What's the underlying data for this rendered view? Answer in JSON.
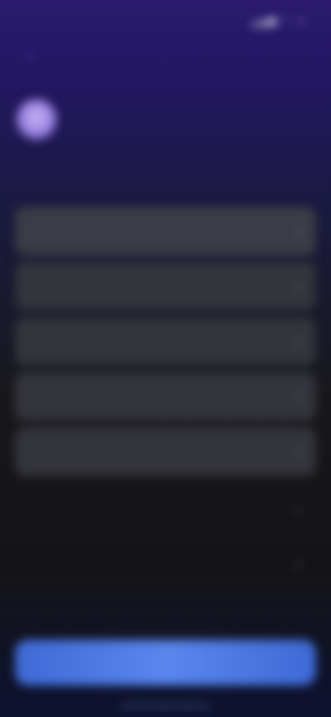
{
  "status_bar": {
    "time": "",
    "icons": [
      "signal-icon",
      "wifi-icon",
      "battery-icon"
    ],
    "icons_text": ""
  },
  "nav": {
    "back_label": ""
  },
  "profile": {
    "initial": "",
    "name": "",
    "subtitle": "",
    "description": ""
  },
  "menu": {
    "items": [
      {
        "label": ""
      },
      {
        "label": ""
      },
      {
        "label": ""
      },
      {
        "label": ""
      },
      {
        "label": ""
      },
      {
        "label": ""
      },
      {
        "label": ""
      }
    ]
  },
  "primary_button": {
    "label": ""
  },
  "colors": {
    "accent": "#5a86ee",
    "background_top": "#2a1a6e",
    "card": "#34343c"
  }
}
